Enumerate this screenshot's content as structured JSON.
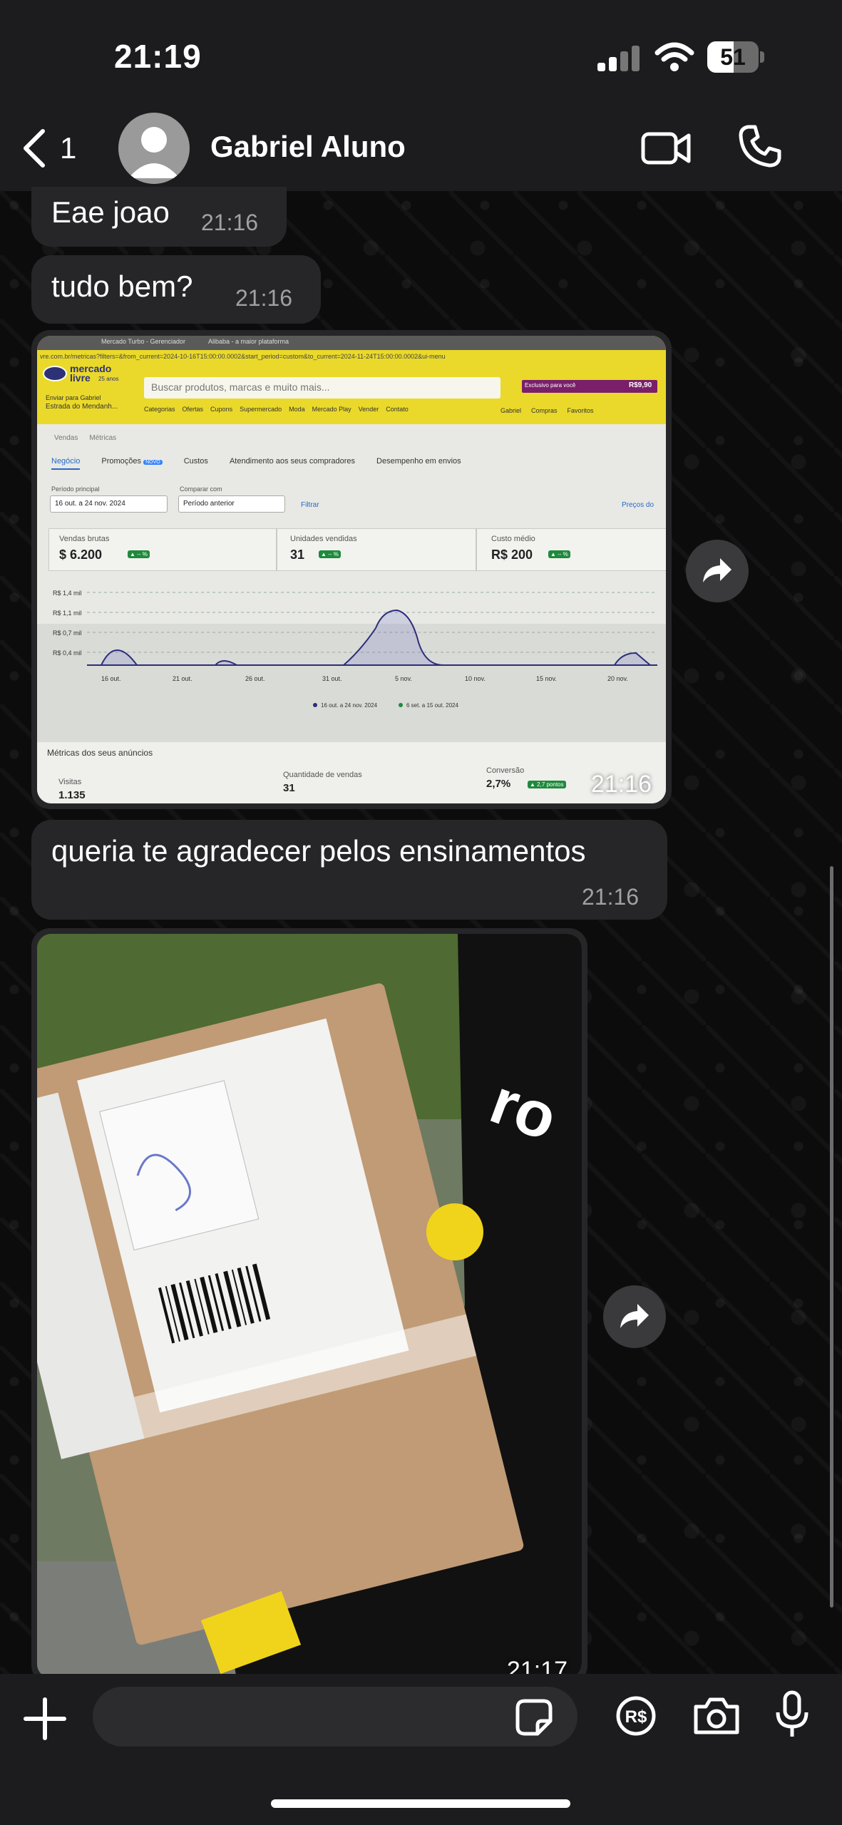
{
  "status_bar": {
    "time": "21:19",
    "battery_percent": "51",
    "battery_level": 0.51
  },
  "header": {
    "unread_count": "1",
    "contact_name": "Gabriel Aluno",
    "icons": [
      "back-chevron-icon",
      "avatar-placeholder-icon",
      "video-call-icon",
      "phone-call-icon"
    ]
  },
  "messages": [
    {
      "type": "text",
      "text": "Eae joao",
      "time": "21:16"
    },
    {
      "type": "text",
      "text": "tudo bem?",
      "time": "21:16"
    },
    {
      "type": "image",
      "time": "21:16",
      "screenshot": {
        "tab1": "Mercado Turbo - Gerenciador",
        "tab2": "Alibaba - a maior plataforma",
        "url": "vre.com.br/metricas?filters=&from_current=2024-10-16T15:00:00.0002&start_period=custom&to_current=2024-11-24T15:00:00.0002&ui-menu",
        "logo": "mercado livre",
        "logo_sub": "25 anos",
        "search_placeholder": "Buscar produtos, marcas e muito mais...",
        "promo": "Exclusivo para você",
        "promo_price": "R$9,90",
        "address_line1": "Enviar para Gabriel",
        "address_line2": "Estrada do Mendanh...",
        "nav": [
          "Categorias",
          "Ofertas",
          "Cupons",
          "Supermercado",
          "Moda",
          "Mercado Play",
          "Vender",
          "Contato"
        ],
        "user_links": [
          "Gabriel",
          "Compras",
          "Favoritos"
        ],
        "breadcrumb": [
          "Vendas",
          "Métricas"
        ],
        "tabs": [
          "Negócio",
          "Promoções",
          "Custos",
          "Atendimento aos seus compradores",
          "Desempenho em envios"
        ],
        "new_badge": "NOVO",
        "period_label": "Período principal",
        "period_value": "16 out. a 24 nov. 2024",
        "compare_label": "Comparar com",
        "compare_value": "Período anterior",
        "filter_label": "Filtrar",
        "price_link": "Preços do",
        "kpis": [
          {
            "label": "Vendas brutas",
            "value": "$ 6.200",
            "delta": "▲ -- %"
          },
          {
            "label": "Unidades vendidas",
            "value": "31",
            "delta": "▲ -- %"
          },
          {
            "label": "Custo médio",
            "value": "R$ 200",
            "delta": "▲ -- %"
          }
        ],
        "y_ticks": [
          "R$ 1,4 mil",
          "R$ 1,1 mil",
          "R$ 0,7 mil",
          "R$ 0,4 mil"
        ],
        "x_ticks": [
          "16 out.",
          "21 out.",
          "26 out.",
          "31 out.",
          "5 nov.",
          "10 nov.",
          "15 nov.",
          "20 nov."
        ],
        "legend": [
          "16 out. a 24 nov. 2024",
          "6 set. a 15 out. 2024"
        ],
        "metrics_title": "Métricas dos seus anúncios",
        "metrics": [
          {
            "label": "Visitas",
            "value": "1.135"
          },
          {
            "label": "Quantidade de vendas",
            "value": "31"
          },
          {
            "label": "Conversão",
            "value": "2,7%",
            "delta": "▲ 2,7 pontos"
          }
        ]
      }
    },
    {
      "type": "text",
      "text": "queria te agradecer pelos ensinamentos",
      "time": "21:16"
    },
    {
      "type": "image",
      "time": "21:17",
      "description_icon": "package-photo"
    }
  ],
  "composer": {
    "icons": [
      "plus-icon",
      "sticker-icon",
      "pix-icon",
      "camera-icon",
      "mic-icon"
    ]
  },
  "colors": {
    "bubble": "#262628",
    "bar": "#1c1c1e",
    "ml_yellow": "#ead92a"
  }
}
